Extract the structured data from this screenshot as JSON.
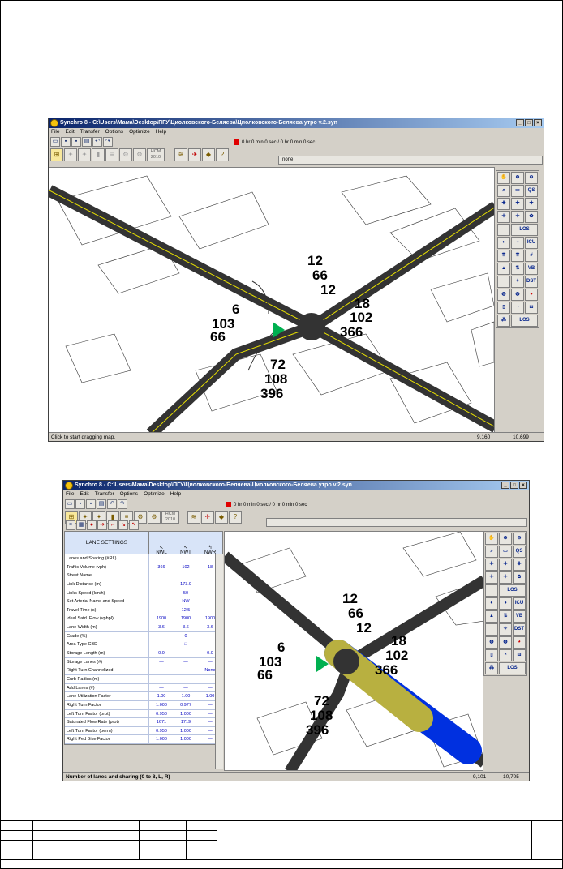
{
  "top_window": {
    "title": "Synchro 8 - C:\\Users\\Мама\\Desktop\\ПГУ\\Циолковского-Беляева\\Циолковского-Беляева утро v.2.syn",
    "menu": [
      "File",
      "Edit",
      "Transfer",
      "Options",
      "Optimize",
      "Help"
    ],
    "timer": "0 hr  0 min  0 sec /   0 hr  0 min  0 sec",
    "none_label": "none",
    "hcm_label": "HCM 2010",
    "palette": [
      "LOS",
      "ICU",
      "VB",
      "DST",
      "LOS"
    ],
    "status": "Click to start dragging map.",
    "coord_x": "9,160",
    "coord_y": "10,699",
    "volumes": {
      "nw_group": [
        "12",
        "66",
        "12"
      ],
      "ne_group": [
        "18",
        "102",
        "366"
      ],
      "sw_group": [
        "6",
        "103",
        "66"
      ],
      "se_group": [
        "72",
        "108",
        "396"
      ]
    }
  },
  "bottom_window": {
    "title": "Synchro 8 - C:\\Users\\Мама\\Desktop\\ПГУ\\Циолковского-Беляева\\Циолковского-Беляева утро v.2.syn",
    "menu": [
      "File",
      "Edit",
      "Transfer",
      "Options",
      "Optimize",
      "Help"
    ],
    "timer": "0 hr  0 min  0 sec /   0 hr  0 min  0 sec",
    "hcm_label": "HCM 2010",
    "grid_header": "LANE SETTINGS",
    "columns": [
      "NWL",
      "NWT",
      "NWR"
    ],
    "rows": [
      {
        "k": "Lanes and Sharing (#RL)",
        "a": "",
        "b": "",
        "c": ""
      },
      {
        "k": "Traffic Volume (vph)",
        "a": "366",
        "b": "102",
        "c": "18"
      },
      {
        "k": "Street Name",
        "a": "",
        "b": "",
        "c": ""
      },
      {
        "k": "Link Distance (m)",
        "a": "—",
        "b": "173.9",
        "c": "—"
      },
      {
        "k": "Links Speed (km/h)",
        "a": "—",
        "b": "50",
        "c": "—"
      },
      {
        "k": "Set Arterial Name and Speed",
        "a": "—",
        "b": "NW",
        "c": "—"
      },
      {
        "k": "Travel Time (s)",
        "a": "—",
        "b": "12.5",
        "c": "—"
      },
      {
        "k": "Ideal Satd. Flow (vphpl)",
        "a": "1900",
        "b": "1900",
        "c": "1900"
      },
      {
        "k": "Lane Width (m)",
        "a": "3.6",
        "b": "3.6",
        "c": "3.6"
      },
      {
        "k": "Grade (%)",
        "a": "—",
        "b": "0",
        "c": "—"
      },
      {
        "k": "Area Type CBD",
        "a": "—",
        "b": "□",
        "c": "—"
      },
      {
        "k": "Storage Length (m)",
        "a": "0.0",
        "b": "—",
        "c": "0.0"
      },
      {
        "k": "Storage Lanes (#)",
        "a": "—",
        "b": "—",
        "c": "—"
      },
      {
        "k": "Right Turn Channelized",
        "a": "—",
        "b": "—",
        "c": "None"
      },
      {
        "k": "Curb Radius (m)",
        "a": "—",
        "b": "—",
        "c": "—"
      },
      {
        "k": "Add Lanes (#)",
        "a": "—",
        "b": "—",
        "c": "—"
      },
      {
        "k": "Lane Utilization Factor",
        "a": "1.00",
        "b": "1.00",
        "c": "1.00"
      },
      {
        "k": "Right Turn Factor",
        "a": "1.000",
        "b": "0.977",
        "c": "—"
      },
      {
        "k": "Left Turn Factor (prot)",
        "a": "0.950",
        "b": "1.000",
        "c": "—"
      },
      {
        "k": "Saturated Flow Rate (prot)",
        "a": "1671",
        "b": "1719",
        "c": "—"
      },
      {
        "k": "Left Turn Factor (perm)",
        "a": "0.950",
        "b": "1.000",
        "c": "—"
      },
      {
        "k": "Right Ped Bike Factor",
        "a": "1.000",
        "b": "1.000",
        "c": "—"
      }
    ],
    "status": "Number of lanes and sharing (0 to 8, L, R)",
    "coord_x": "9,101",
    "coord_y": "10,705",
    "palette": [
      "LOS",
      "ICU",
      "VB",
      "DST",
      "LOS"
    ],
    "volumes": {
      "nw_group": [
        "12",
        "66",
        "12"
      ],
      "ne_group": [
        "18",
        "102",
        "366"
      ],
      "sw_group": [
        "6",
        "103",
        "66"
      ],
      "se_group": [
        "72",
        "108",
        "396"
      ]
    }
  },
  "colors": {
    "road": "#3a3a3a",
    "centerline": "#e8e000",
    "highlight_blue": "#0030e0",
    "highlight_olive": "#b8b040",
    "signal_green": "#00b050"
  }
}
